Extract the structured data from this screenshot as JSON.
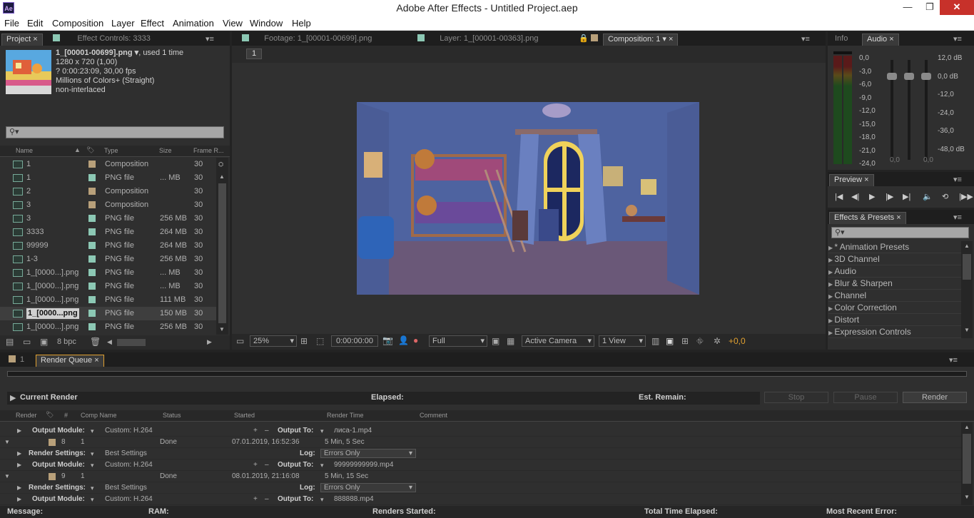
{
  "window": {
    "title": "Adobe After Effects - Untitled Project.aep",
    "icon": "Ae"
  },
  "menu": [
    "File",
    "Edit",
    "Composition",
    "Layer",
    "Effect",
    "Animation",
    "View",
    "Window",
    "Help"
  ],
  "project": {
    "tabs": {
      "project": "Project",
      "effect_controls": "Effect Controls: 3333"
    },
    "file_name": "1_[00001-00699].png ▾",
    "used": ", used 1 time",
    "info": [
      "1280 x 720 (1,00)",
      "? 0:00:23:09, 30,00 fps",
      "Millions of Colors+ (Straight)",
      "non-interlaced"
    ],
    "search_placeholder": "",
    "columns": {
      "name": "Name",
      "type": "Type",
      "size": "Size",
      "frame": "Frame R..."
    },
    "rows": [
      {
        "name": "1",
        "type": "Composition",
        "size": "",
        "frame": "30",
        "color": "#b8a07a"
      },
      {
        "name": "1",
        "type": "PNG file",
        "size": "... MB",
        "frame": "30",
        "color": "#8cc8b4"
      },
      {
        "name": "2",
        "type": "Composition",
        "size": "",
        "frame": "30",
        "color": "#b8a07a"
      },
      {
        "name": "3",
        "type": "Composition",
        "size": "",
        "frame": "30",
        "color": "#b8a07a"
      },
      {
        "name": "3",
        "type": "PNG file",
        "size": "256 MB",
        "frame": "30",
        "color": "#8cc8b4"
      },
      {
        "name": "3333",
        "type": "PNG file",
        "size": "264 MB",
        "frame": "30",
        "color": "#8cc8b4"
      },
      {
        "name": "99999",
        "type": "PNG file",
        "size": "264 MB",
        "frame": "30",
        "color": "#8cc8b4"
      },
      {
        "name": "1-3",
        "type": "PNG file",
        "size": "256 MB",
        "frame": "30",
        "color": "#8cc8b4"
      },
      {
        "name": "1_[0000...].png",
        "type": "PNG file",
        "size": "... MB",
        "frame": "30",
        "color": "#8cc8b4"
      },
      {
        "name": "1_[0000...].png",
        "type": "PNG file",
        "size": "... MB",
        "frame": "30",
        "color": "#8cc8b4"
      },
      {
        "name": "1_[0000...].png",
        "type": "PNG file",
        "size": "111 MB",
        "frame": "30",
        "color": "#8cc8b4"
      },
      {
        "name": "1_[0000...png",
        "type": "PNG file",
        "size": "150 MB",
        "frame": "30",
        "color": "#8cc8b4",
        "selected": true
      },
      {
        "name": "1_[0000...].png",
        "type": "PNG file",
        "size": "256 MB",
        "frame": "30",
        "color": "#8cc8b4"
      }
    ],
    "bpc": "8 bpc"
  },
  "viewer": {
    "tabs": {
      "footage": "Footage: 1_[00001-00699].png",
      "layer": "Layer: 1_[00001-00363].png",
      "composition": "Composition: 1"
    },
    "comp_label": "1",
    "zoom": "25%",
    "timecode": "0:00:00:00",
    "resolution": "Full",
    "camera": "Active Camera",
    "views": "1 View",
    "exposure": "+0,0"
  },
  "audio": {
    "tabs": {
      "info": "Info",
      "audio": "Audio"
    },
    "left_scale": [
      "0,0",
      "-3,0",
      "-6,0",
      "-9,0",
      "-12,0",
      "-15,0",
      "-18,0",
      "-21,0",
      "-24,0"
    ],
    "right_scale": [
      "12,0 dB",
      "0,0 dB",
      "-12,0",
      "-24,0",
      "-36,0",
      "-48,0 dB"
    ],
    "slider_values": [
      "0,0",
      "0,0"
    ]
  },
  "preview": {
    "tab": "Preview"
  },
  "effects": {
    "tab": "Effects & Presets",
    "items": [
      "* Animation Presets",
      "3D Channel",
      "Audio",
      "Blur & Sharpen",
      "Channel",
      "Color Correction",
      "Distort",
      "Expression Controls"
    ]
  },
  "render_queue": {
    "tabs": {
      "comp": "1",
      "render_queue": "Render Queue"
    },
    "current_render": "Current Render",
    "elapsed": "Elapsed:",
    "est_remain": "Est. Remain:",
    "buttons": {
      "stop": "Stop",
      "pause": "Pause",
      "render": "Render"
    },
    "columns": {
      "render": "Render",
      "num": "#",
      "comp": "Comp Name",
      "status": "Status",
      "started": "Started",
      "render_time": "Render Time",
      "comment": "Comment"
    },
    "rows": [
      {
        "kind": "module",
        "label": "Output Module:",
        "value": "Custom: H.264",
        "out_label": "Output To:",
        "out_value": "лиса-1.mp4"
      },
      {
        "kind": "item",
        "num": "8",
        "comp": "1",
        "status": "Done",
        "started": "07.01.2019, 16:52:36",
        "time": "5 Min, 5 Sec"
      },
      {
        "kind": "settings",
        "label": "Render Settings:",
        "value": "Best Settings",
        "log_label": "Log:",
        "log_value": "Errors Only"
      },
      {
        "kind": "module",
        "label": "Output Module:",
        "value": "Custom: H.264",
        "out_label": "Output To:",
        "out_value": "99999999999.mp4"
      },
      {
        "kind": "item",
        "num": "9",
        "comp": "1",
        "status": "Done",
        "started": "08.01.2019, 21:16:08",
        "time": "5 Min, 15 Sec"
      },
      {
        "kind": "settings",
        "label": "Render Settings:",
        "value": "Best Settings",
        "log_label": "Log:",
        "log_value": "Errors Only"
      },
      {
        "kind": "module",
        "label": "Output Module:",
        "value": "Custom: H.264",
        "out_label": "Output To:",
        "out_value": "888888.mp4"
      }
    ]
  },
  "status": {
    "message": "Message:",
    "ram": "RAM:",
    "renders_started": "Renders Started:",
    "total_elapsed": "Total Time Elapsed:",
    "recent_error": "Most Recent Error:"
  }
}
